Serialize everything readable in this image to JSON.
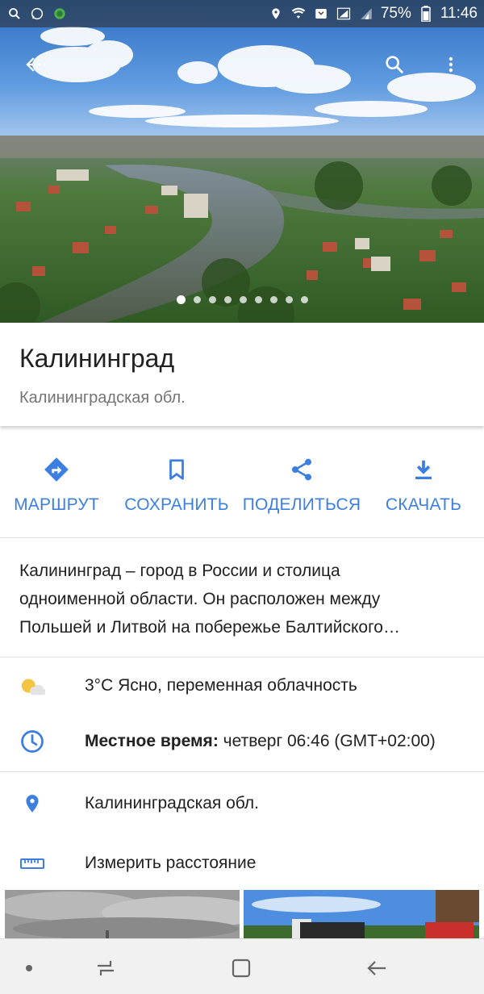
{
  "status_bar": {
    "battery": "75%",
    "time": "11:46",
    "left_icons": [
      "search-icon",
      "whatsapp-icon",
      "app-icon"
    ],
    "right_icons": [
      "location-icon",
      "wifi-icon",
      "nfc-icon",
      "signal-icon",
      "signal-icon",
      "battery-icon"
    ]
  },
  "hero": {
    "photo_count": 9,
    "active_photo": 1,
    "top_icons": [
      "back-arrow-icon",
      "search-icon",
      "more-vert-icon"
    ]
  },
  "place": {
    "title": "Калининград",
    "subtitle": "Калининградская обл."
  },
  "actions": [
    {
      "label": "МАРШРУТ",
      "icon": "directions-icon"
    },
    {
      "label": "СОХРАНИТЬ",
      "icon": "bookmark-icon"
    },
    {
      "label": "ПОДЕЛИТЬСЯ",
      "icon": "share-icon"
    },
    {
      "label": "СКАЧАТЬ",
      "icon": "download-icon"
    }
  ],
  "description": {
    "lines": [
      "Калининград – город в России и столица",
      "одноименной области. Он расположен между",
      "Польшей и Литвой на побережье Балтийского…"
    ]
  },
  "info": {
    "weather": "3°C Ясно, переменная облачность",
    "local_time_label": "Местное время:",
    "local_time_value": " четверг 06:46 (GMT+02:00)",
    "region": "Калининградская обл.",
    "measure": "Измерить расстояние"
  },
  "colors": {
    "accent": "#3d7fe0",
    "text_primary": "#212121",
    "text_secondary": "#757575"
  },
  "navbar": {
    "icons": [
      "home-dot-icon",
      "recents-icon",
      "overview-icon",
      "back-icon"
    ]
  }
}
